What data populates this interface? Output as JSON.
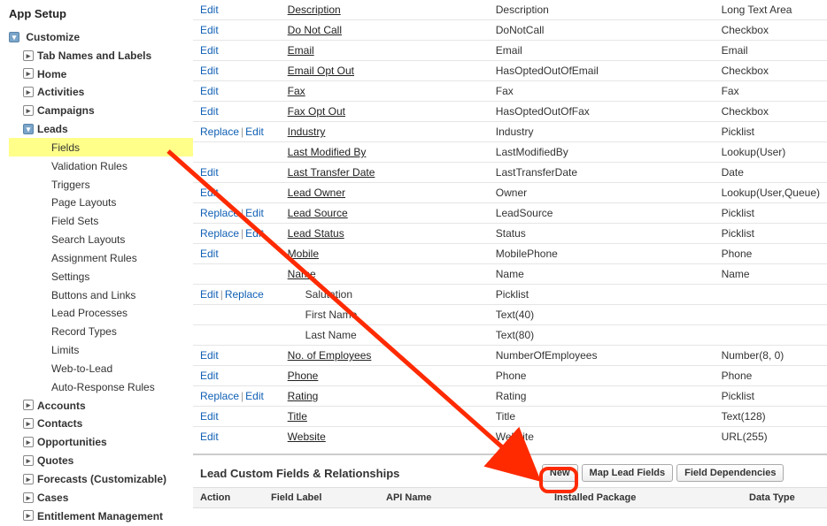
{
  "sidebar": {
    "title": "App Setup",
    "customize": {
      "label": "Customize",
      "items": [
        {
          "label": "Tab Names and Labels"
        },
        {
          "label": "Home"
        },
        {
          "label": "Activities"
        },
        {
          "label": "Campaigns"
        }
      ],
      "leads": {
        "label": "Leads",
        "children": [
          "Fields",
          "Validation Rules",
          "Triggers",
          "Page Layouts",
          "Field Sets",
          "Search Layouts",
          "Assignment Rules",
          "Settings",
          "Buttons and Links",
          "Lead Processes",
          "Record Types",
          "Limits",
          "Web-to-Lead",
          "Auto-Response Rules"
        ]
      },
      "after": [
        "Accounts",
        "Contacts",
        "Opportunities",
        "Quotes",
        "Forecasts (Customizable)",
        "Cases",
        "Entitlement Management"
      ]
    }
  },
  "actions": {
    "edit": "Edit",
    "replace": "Replace"
  },
  "fields": [
    {
      "act": [
        "edit"
      ],
      "label": "Description",
      "api": "Description",
      "type": "Long Text Area"
    },
    {
      "act": [
        "edit"
      ],
      "label": "Do Not Call",
      "api": "DoNotCall",
      "type": "Checkbox"
    },
    {
      "act": [
        "edit"
      ],
      "label": "Email",
      "api": "Email",
      "type": "Email"
    },
    {
      "act": [
        "edit"
      ],
      "label": "Email Opt Out",
      "api": "HasOptedOutOfEmail",
      "type": "Checkbox"
    },
    {
      "act": [
        "edit"
      ],
      "label": "Fax",
      "api": "Fax",
      "type": "Fax"
    },
    {
      "act": [
        "edit"
      ],
      "label": "Fax Opt Out",
      "api": "HasOptedOutOfFax",
      "type": "Checkbox"
    },
    {
      "act": [
        "replace",
        "edit"
      ],
      "label": "Industry",
      "api": "Industry",
      "type": "Picklist"
    },
    {
      "act": [],
      "label": "Last Modified By",
      "api": "LastModifiedBy",
      "type": "Lookup(User)"
    },
    {
      "act": [
        "edit"
      ],
      "label": "Last Transfer Date",
      "api": "LastTransferDate",
      "type": "Date"
    },
    {
      "act": [
        "edit"
      ],
      "label": "Lead Owner",
      "api": "Owner",
      "type": "Lookup(User,Queue)"
    },
    {
      "act": [
        "replace",
        "edit"
      ],
      "label": "Lead Source",
      "api": "LeadSource",
      "type": "Picklist"
    },
    {
      "act": [
        "replace",
        "edit"
      ],
      "label": "Lead Status",
      "api": "Status",
      "type": "Picklist"
    },
    {
      "act": [
        "edit"
      ],
      "label": "Mobile",
      "api": "MobilePhone",
      "type": "Phone"
    },
    {
      "act": [],
      "label": "Name",
      "api": "Name",
      "type": "Name"
    },
    {
      "act": [
        "edit",
        "replace"
      ],
      "label": "Salutation",
      "api": "Picklist",
      "type": "",
      "indent": true
    },
    {
      "act": [],
      "label": "First Name",
      "api": "Text(40)",
      "type": "",
      "indent": true
    },
    {
      "act": [],
      "label": "Last Name",
      "api": "Text(80)",
      "type": "",
      "indent": true
    },
    {
      "act": [
        "edit"
      ],
      "label": "No. of Employees",
      "api": "NumberOfEmployees",
      "type": "Number(8, 0)"
    },
    {
      "act": [
        "edit"
      ],
      "label": "Phone",
      "api": "Phone",
      "type": "Phone"
    },
    {
      "act": [
        "replace",
        "edit"
      ],
      "label": "Rating",
      "api": "Rating",
      "type": "Picklist"
    },
    {
      "act": [
        "edit"
      ],
      "label": "Title",
      "api": "Title",
      "type": "Text(128)"
    },
    {
      "act": [
        "edit"
      ],
      "label": "Website",
      "api": "Website",
      "type": "URL(255)"
    }
  ],
  "customSection": {
    "title": "Lead Custom Fields & Relationships",
    "buttons": {
      "new": "New",
      "map": "Map Lead Fields",
      "deps": "Field Dependencies"
    },
    "columns": [
      "Action",
      "Field Label",
      "API Name",
      "Installed Package",
      "Data Type"
    ]
  }
}
